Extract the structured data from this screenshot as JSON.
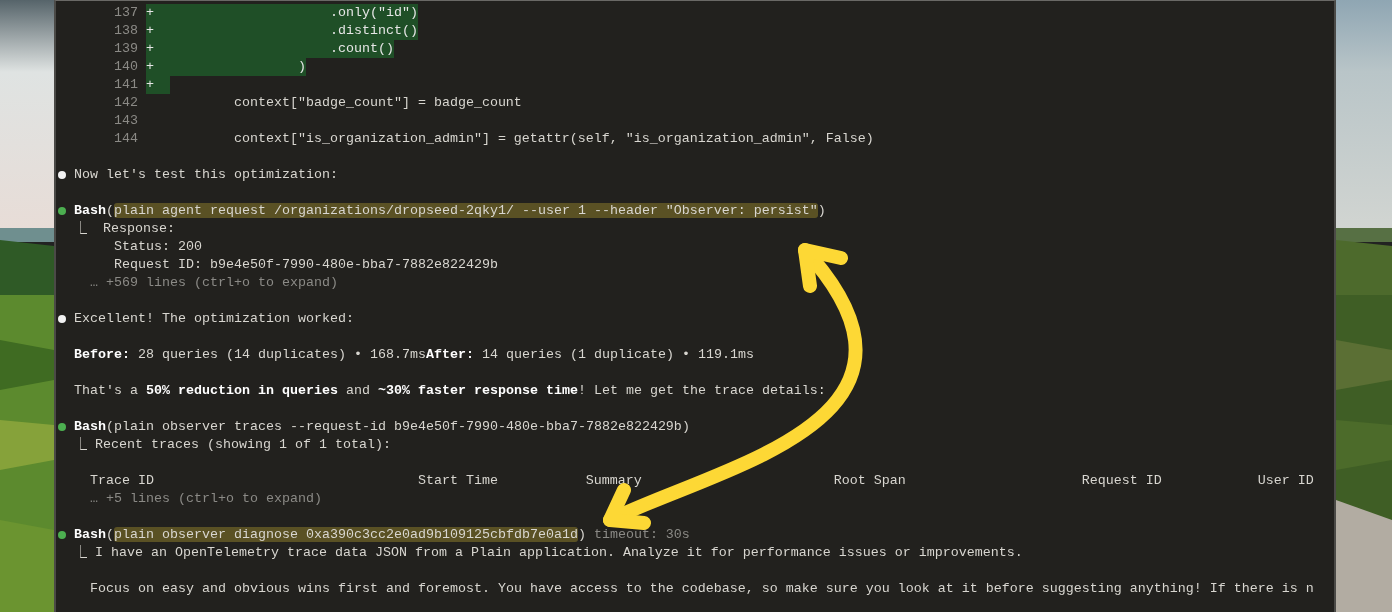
{
  "diff": {
    "rows": [
      {
        "number": "137",
        "marker": "+",
        "code": "                      .only(\"id\")",
        "added": true
      },
      {
        "number": "138",
        "marker": "+",
        "code": "                      .distinct()",
        "added": true
      },
      {
        "number": "139",
        "marker": "+",
        "code": "                      .count()",
        "added": true
      },
      {
        "number": "140",
        "marker": "+",
        "code": "                  )",
        "added": true
      },
      {
        "number": "141",
        "marker": "+",
        "added": true
      },
      {
        "number": "142",
        "code": "          context[\"badge_count\"] = badge_count",
        "added": false
      },
      {
        "number": "143",
        "added": false
      },
      {
        "number": "144",
        "code": "          context[\"is_organization_admin\"] = getattr(self, \"is_organization_admin\", False)",
        "added": false
      }
    ]
  },
  "transcript": [
    {
      "kind": "message",
      "paragraphs": [
        "Now let's test this optimization:"
      ]
    },
    {
      "kind": "tool",
      "tool": "Bash",
      "open": "(",
      "command": "plain agent request /organizations/dropseed-2qky1/ --user 1 --header \"Observer: persist\"",
      "close": ")",
      "highlighted": true,
      "output": [
        {
          "kind": "text",
          "text": "⎿  Response:"
        },
        {
          "kind": "text",
          "text": "     Status: 200"
        },
        {
          "kind": "text",
          "text": "     Request ID: b9e4e50f-7990-480e-bba7-7882e822429b"
        },
        {
          "kind": "more",
          "text": "  … +569 lines (ctrl+o to expand)"
        }
      ]
    },
    {
      "kind": "message",
      "paragraphs": [
        "Excellent! The optimization worked:",
        "**Before:** 28 queries (14 duplicates) • 168.7ms**After:** 14 queries (1 duplicate) • 119.1ms",
        "That's a **50% reduction in queries** and **~30% faster response time**! Let me get the trace details:"
      ]
    },
    {
      "kind": "tool",
      "tool": "Bash",
      "open": "(",
      "command": "plain observer traces --request-id b9e4e50f-7990-480e-bba7-7882e822429b",
      "close": ")",
      "highlighted": false,
      "output": [
        {
          "kind": "text",
          "text": "⎿ Recent traces (showing 1 of 1 total):"
        },
        {
          "kind": "table",
          "cells": [
            "Trace ID",
            "Start Time",
            "Summary",
            "Root Span",
            "Request ID",
            "User ID"
          ]
        },
        {
          "kind": "more",
          "text": "  … +5 lines (ctrl+o to expand)"
        }
      ]
    },
    {
      "kind": "tool",
      "tool": "Bash",
      "open": "(",
      "command": "plain observer diagnose 0xa390c3cc2e0ad9b109125cbfdb7e0a1d",
      "close": ")",
      "highlighted": true,
      "note": "timeout: 30s",
      "output": [
        {
          "kind": "text",
          "text": "⎿ I have an OpenTelemetry trace data JSON from a Plain application. Analyze it for performance issues or improvements."
        },
        {
          "kind": "gap"
        },
        {
          "kind": "text",
          "text": "  Focus on easy and obvious wins first and foremost. You have access to the codebase, so make sure you look at it before suggesting anything! If there is n"
        }
      ]
    }
  ]
}
